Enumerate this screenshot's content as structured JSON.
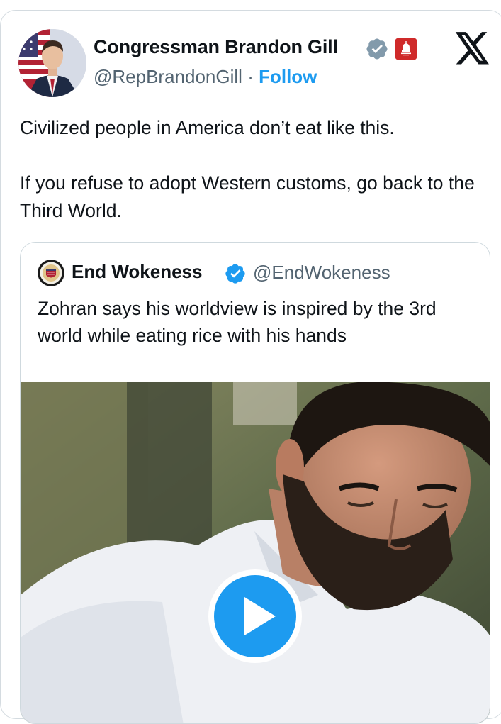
{
  "author": {
    "name": "Congressman Brandon Gill",
    "handle": "@RepBrandonGill",
    "separator": "·",
    "follow_label": "Follow",
    "verified_icon": "verified-badge-icon",
    "affiliation_icon": "government-affiliation-icon"
  },
  "tweet": {
    "line1": "Civilized people in America don’t eat like this.",
    "line2": "If you refuse to adopt Western customs, go back to the Third World."
  },
  "quoted": {
    "name": "End Wokeness",
    "handle": "@EndWokeness",
    "text": "Zohran says his worldview is inspired by the 3rd world while eating rice with his hands",
    "media_type": "video"
  },
  "colors": {
    "accent": "#1d9bf0",
    "text": "#0f1419",
    "secondary_text": "#536471",
    "verified_main": "#829aab",
    "verified_quoted": "#1d9bf0"
  }
}
